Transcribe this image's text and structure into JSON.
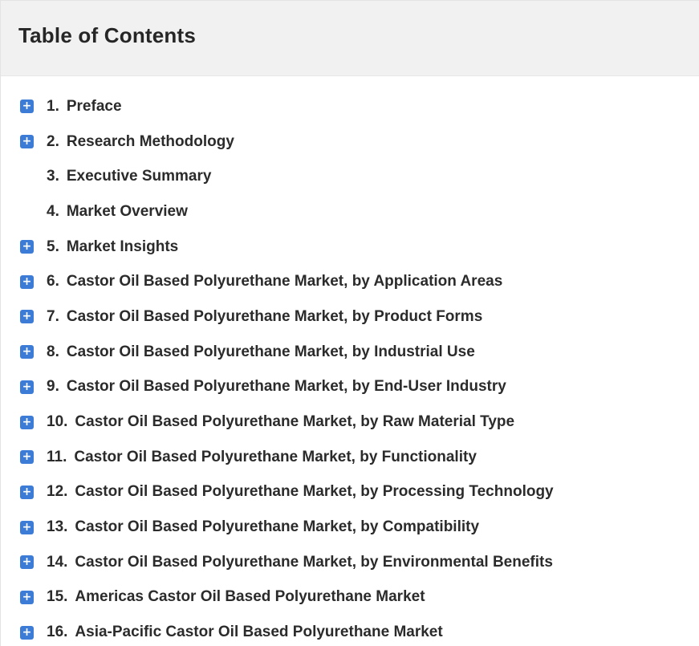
{
  "toc": {
    "title": "Table of Contents",
    "accent_color": "#3c7cd6",
    "items": [
      {
        "num": "1.",
        "label": "Preface",
        "expandable": true
      },
      {
        "num": "2.",
        "label": "Research Methodology",
        "expandable": true
      },
      {
        "num": "3.",
        "label": "Executive Summary",
        "expandable": false
      },
      {
        "num": "4.",
        "label": "Market Overview",
        "expandable": false
      },
      {
        "num": "5.",
        "label": "Market Insights",
        "expandable": true
      },
      {
        "num": "6.",
        "label": "Castor Oil Based Polyurethane Market, by Application Areas",
        "expandable": true
      },
      {
        "num": "7.",
        "label": "Castor Oil Based Polyurethane Market, by Product Forms",
        "expandable": true
      },
      {
        "num": "8.",
        "label": "Castor Oil Based Polyurethane Market, by Industrial Use",
        "expandable": true
      },
      {
        "num": "9.",
        "label": "Castor Oil Based Polyurethane Market, by End-User Industry",
        "expandable": true
      },
      {
        "num": "10.",
        "label": "Castor Oil Based Polyurethane Market, by Raw Material Type",
        "expandable": true
      },
      {
        "num": "11.",
        "label": "Castor Oil Based Polyurethane Market, by Functionality",
        "expandable": true
      },
      {
        "num": "12.",
        "label": "Castor Oil Based Polyurethane Market, by Processing Technology",
        "expandable": true
      },
      {
        "num": "13.",
        "label": "Castor Oil Based Polyurethane Market, by Compatibility",
        "expandable": true
      },
      {
        "num": "14.",
        "label": "Castor Oil Based Polyurethane Market, by Environmental Benefits",
        "expandable": true
      },
      {
        "num": "15.",
        "label": "Americas Castor Oil Based Polyurethane Market",
        "expandable": true
      },
      {
        "num": "16.",
        "label": "Asia-Pacific Castor Oil Based Polyurethane Market",
        "expandable": true
      }
    ]
  }
}
